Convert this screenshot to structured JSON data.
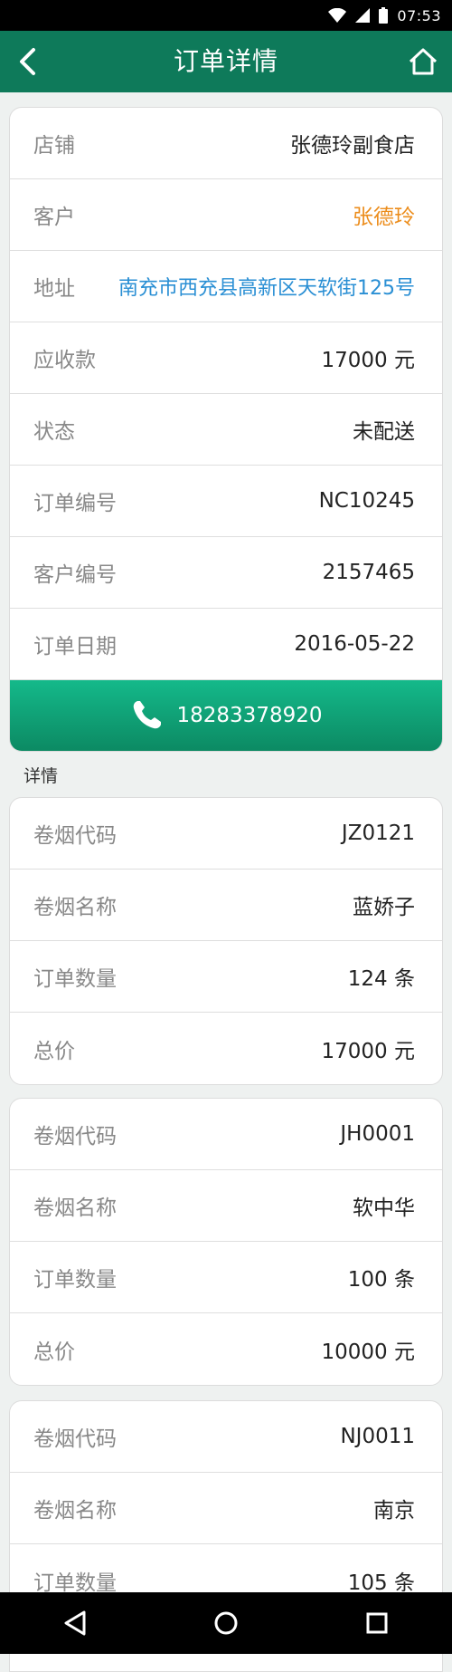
{
  "status_bar": {
    "time": "07:53"
  },
  "header": {
    "title": "订单详情"
  },
  "order": {
    "rows": [
      {
        "label": "店铺",
        "value": "张德玲副食店"
      },
      {
        "label": "客户",
        "value": "张德玲"
      },
      {
        "label": "地址",
        "value": "南充市西充县高新区天软街125号"
      },
      {
        "label": "应收款",
        "value": "17000 元"
      },
      {
        "label": "状态",
        "value": "未配送"
      },
      {
        "label": "订单编号",
        "value": "NC10245"
      },
      {
        "label": "客户编号",
        "value": "2157465"
      },
      {
        "label": "订单日期",
        "value": "2016-05-22"
      }
    ],
    "phone": "18283378920"
  },
  "details_label": "详情",
  "details": [
    {
      "rows": [
        {
          "label": "卷烟代码",
          "value": "JZ0121"
        },
        {
          "label": "卷烟名称",
          "value": "蓝娇子"
        },
        {
          "label": "订单数量",
          "value": "124 条"
        },
        {
          "label": "总价",
          "value": "17000 元"
        }
      ]
    },
    {
      "rows": [
        {
          "label": "卷烟代码",
          "value": "JH0001"
        },
        {
          "label": "卷烟名称",
          "value": "软中华"
        },
        {
          "label": "订单数量",
          "value": "100 条"
        },
        {
          "label": "总价",
          "value": "10000 元"
        }
      ]
    },
    {
      "rows": [
        {
          "label": "卷烟代码",
          "value": "NJ0011"
        },
        {
          "label": "卷烟名称",
          "value": "南京"
        },
        {
          "label": "订单数量",
          "value": "105 条"
        }
      ]
    }
  ],
  "colors": {
    "primary": "#0e7a5a",
    "accent_orange": "#ec8d1c",
    "link_blue": "#2a8fd4"
  }
}
